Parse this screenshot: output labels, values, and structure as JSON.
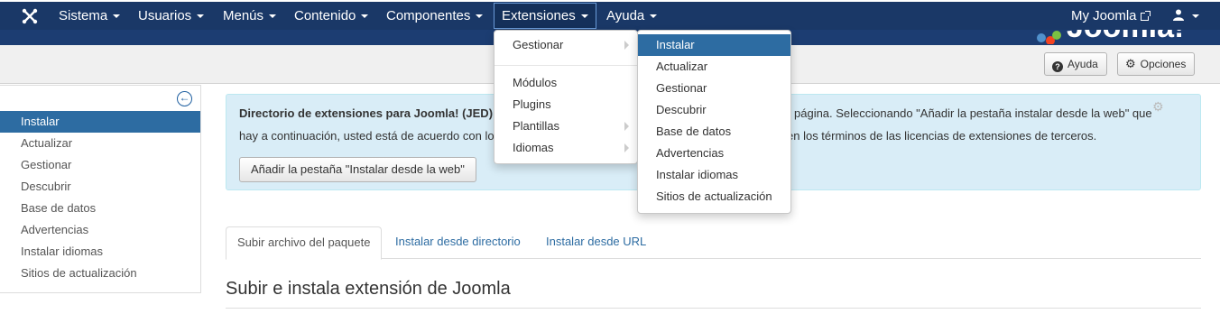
{
  "navbar": {
    "items": [
      {
        "label": "Sistema"
      },
      {
        "label": "Usuarios"
      },
      {
        "label": "Menús"
      },
      {
        "label": "Contenido"
      },
      {
        "label": "Componentes"
      },
      {
        "label": "Extensiones"
      },
      {
        "label": "Ayuda"
      }
    ],
    "my_joomla": "My Joomla",
    "logo_icon": "joomla-logo-icon",
    "user_icon": "user-icon"
  },
  "toolbar": {
    "help_label": "Ayuda",
    "help_icon": "question-circle-icon",
    "options_label": "Opciones",
    "options_icon": "gear-icon"
  },
  "sidebar": {
    "collapse_icon": "arrow-left-circle-icon",
    "items": [
      {
        "label": "Instalar",
        "active": true
      },
      {
        "label": "Actualizar"
      },
      {
        "label": "Gestionar"
      },
      {
        "label": "Descubrir"
      },
      {
        "label": "Base de datos"
      },
      {
        "label": "Advertencias"
      },
      {
        "label": "Instalar idiomas"
      },
      {
        "label": "Sitios de actualización"
      }
    ]
  },
  "info": {
    "line1_bold": "Directorio de extensiones para Joomla! (JED)",
    "line1_rest": "página. Seleccionando \"Añadir la pestaña instalar desde la web\" que",
    "line2_left": "hay a continuación, usted está de acuerdo con lo",
    "line2_right": "en los términos de las licencias de extensiones de terceros.",
    "button_label": "Añadir la pestaña \"Instalar desde la web\""
  },
  "tabs": [
    {
      "label": "Subir archivo del paquete",
      "active": true
    },
    {
      "label": "Instalar desde directorio"
    },
    {
      "label": "Instalar desde URL"
    }
  ],
  "section_title": "Subir e instala extensión de Joomla",
  "extensions_menu": {
    "items": [
      {
        "label": "Gestionar",
        "submenu": true
      },
      {
        "label": "Módulos"
      },
      {
        "label": "Plugins"
      },
      {
        "label": "Plantillas",
        "submenu": true
      },
      {
        "label": "Idiomas",
        "submenu": true
      }
    ]
  },
  "gestionar_submenu": {
    "items": [
      {
        "label": "Instalar",
        "active": true
      },
      {
        "label": "Actualizar"
      },
      {
        "label": "Gestionar"
      },
      {
        "label": "Descubrir"
      },
      {
        "label": "Base de datos"
      },
      {
        "label": "Advertencias"
      },
      {
        "label": "Instalar idiomas"
      },
      {
        "label": "Sitios de actualización"
      }
    ]
  },
  "colors": {
    "navbar": "#1a3867",
    "accent": "#2d6ca2",
    "info_bg": "#d9edf7"
  }
}
